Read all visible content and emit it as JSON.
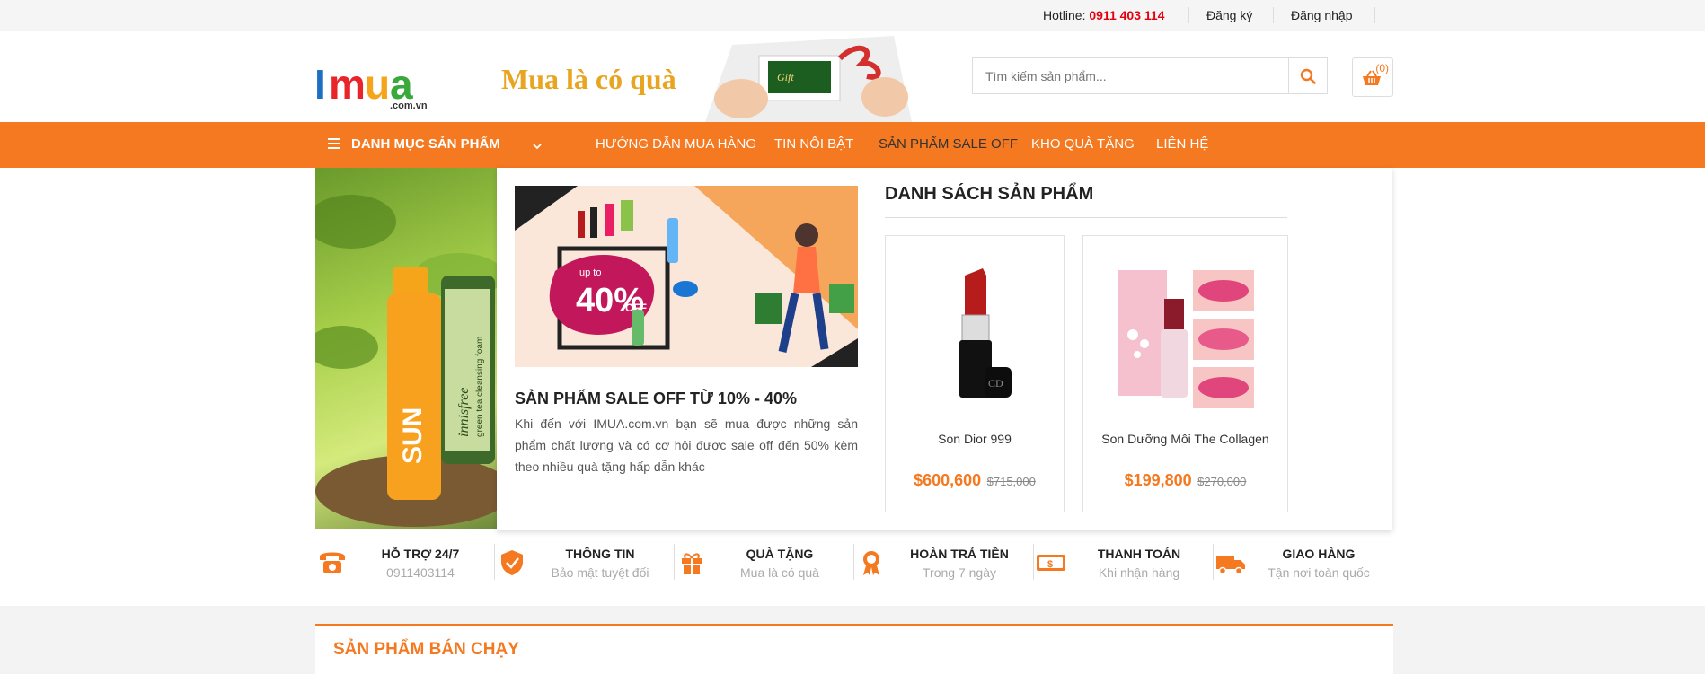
{
  "topbar": {
    "hotline_label": "Hotline:",
    "hotline_number": "0911 403 114",
    "register": "Đăng ký",
    "login": "Đăng nhập"
  },
  "header": {
    "logo_text": "IMUA",
    "logo_sub": ".com.vn",
    "slogan": "Mua là có quà",
    "gift_text": "Gift",
    "search_placeholder": "Tìm kiếm sản phẩm...",
    "cart_count": "(0)"
  },
  "nav": {
    "category": "DANH MỤC SẢN PHẨM",
    "links": [
      "HƯỚNG DẪN MUA HÀNG",
      "TIN NỔI BẬT",
      "SẢN PHẨM SALE OFF",
      "KHO QUÀ TẶNG",
      "LIÊN HỆ"
    ]
  },
  "hero": {
    "product_text_1": "SUN",
    "product_text_2": "innisfree",
    "product_text_3": "green tea cleansing foam"
  },
  "promo": {
    "banner_up_to": "up to",
    "banner_percent": "40%",
    "banner_off": "OFF",
    "title": "SẢN PHẨM SALE OFF TỪ 10% - 40%",
    "description": "Khi đến với IMUA.com.vn bạn sẽ mua được những sản phẩm chất lượng và có cơ hội được sale off đến 50% kèm theo nhiều quà tặng hấp dẫn khác"
  },
  "product_list": {
    "title": "DANH SÁCH SẢN PHẨM",
    "items": [
      {
        "name": "Son Dior 999",
        "price": "$600,600",
        "old_price": "$715,000"
      },
      {
        "name": "Son Dưỡng Môi The Collagen",
        "price": "$199,800",
        "old_price": "$270,000"
      }
    ]
  },
  "features": [
    {
      "title": "HỖ TRỢ 24/7",
      "sub": "0911403114",
      "icon": "phone-icon"
    },
    {
      "title": "THÔNG TIN",
      "sub": "Bảo mật tuyệt đối",
      "icon": "shield-icon"
    },
    {
      "title": "QUÀ TẶNG",
      "sub": "Mua là có quà",
      "icon": "gift-icon"
    },
    {
      "title": "HOÀN TRẢ TIỀN",
      "sub": "Trong 7 ngày",
      "icon": "award-icon"
    },
    {
      "title": "THANH TOÁN",
      "sub": "Khi nhận hàng",
      "icon": "money-icon"
    },
    {
      "title": "GIAO HÀNG",
      "sub": "Tận nơi toàn quốc",
      "icon": "truck-icon"
    }
  ],
  "bestsellers": {
    "title": "SẢN PHẨM BÁN CHẠY"
  },
  "colors": {
    "accent": "#f47920",
    "hotline": "#e3000f",
    "slogan": "#e8a521"
  }
}
